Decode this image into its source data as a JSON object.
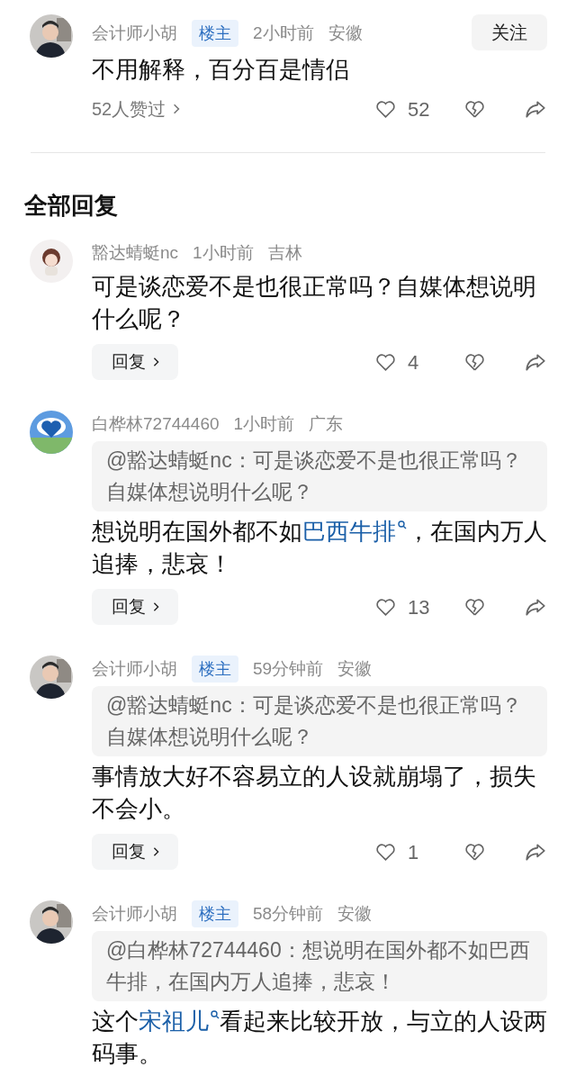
{
  "top_comment": {
    "author": "会计师小胡",
    "badge": "楼主",
    "time": "2小时前",
    "location": "安徽",
    "follow_button": "关注",
    "body": [
      {
        "kind": "text",
        "text": "不用解释，百分百是情侣"
      }
    ],
    "likers": "52人赞过",
    "likes": "52"
  },
  "section_title": "全部回复",
  "replies": [
    {
      "author": "豁达蜻蜓nc",
      "time": "1小时前",
      "location": "吉林",
      "body": [
        {
          "kind": "text",
          "text": "可是谈恋爱不是也很正常吗？自媒体想说明什么呢？"
        }
      ],
      "reply_button": "回复",
      "likes": "4"
    },
    {
      "author": "白桦林72744460",
      "time": "1小时前",
      "location": "广东",
      "quote": "@豁达蜻蜓nc：可是谈恋爱不是也很正常吗？自媒体想说明什么呢？",
      "body": [
        {
          "kind": "text",
          "text": "想说明在国外都不如"
        },
        {
          "kind": "link",
          "text": "巴西牛排"
        },
        {
          "kind": "text",
          "text": "，在国内万人追捧，悲哀！"
        }
      ],
      "reply_button": "回复",
      "likes": "13"
    },
    {
      "author": "会计师小胡",
      "badge": "楼主",
      "time": "59分钟前",
      "location": "安徽",
      "quote": "@豁达蜻蜓nc：可是谈恋爱不是也很正常吗？自媒体想说明什么呢？",
      "body": [
        {
          "kind": "text",
          "text": "事情放大好不容易立的人设就崩塌了，损失不会小。"
        }
      ],
      "reply_button": "回复",
      "likes": "1"
    },
    {
      "author": "会计师小胡",
      "badge": "楼主",
      "time": "58分钟前",
      "location": "安徽",
      "quote": "@白桦林72744460：想说明在国外都不如巴西牛排，在国内万人追捧，悲哀！",
      "body": [
        {
          "kind": "text",
          "text": "这个"
        },
        {
          "kind": "link",
          "text": "宋祖儿"
        },
        {
          "kind": "text",
          "text": "看起来比较开放，与立的人设两码事。"
        }
      ]
    }
  ]
}
